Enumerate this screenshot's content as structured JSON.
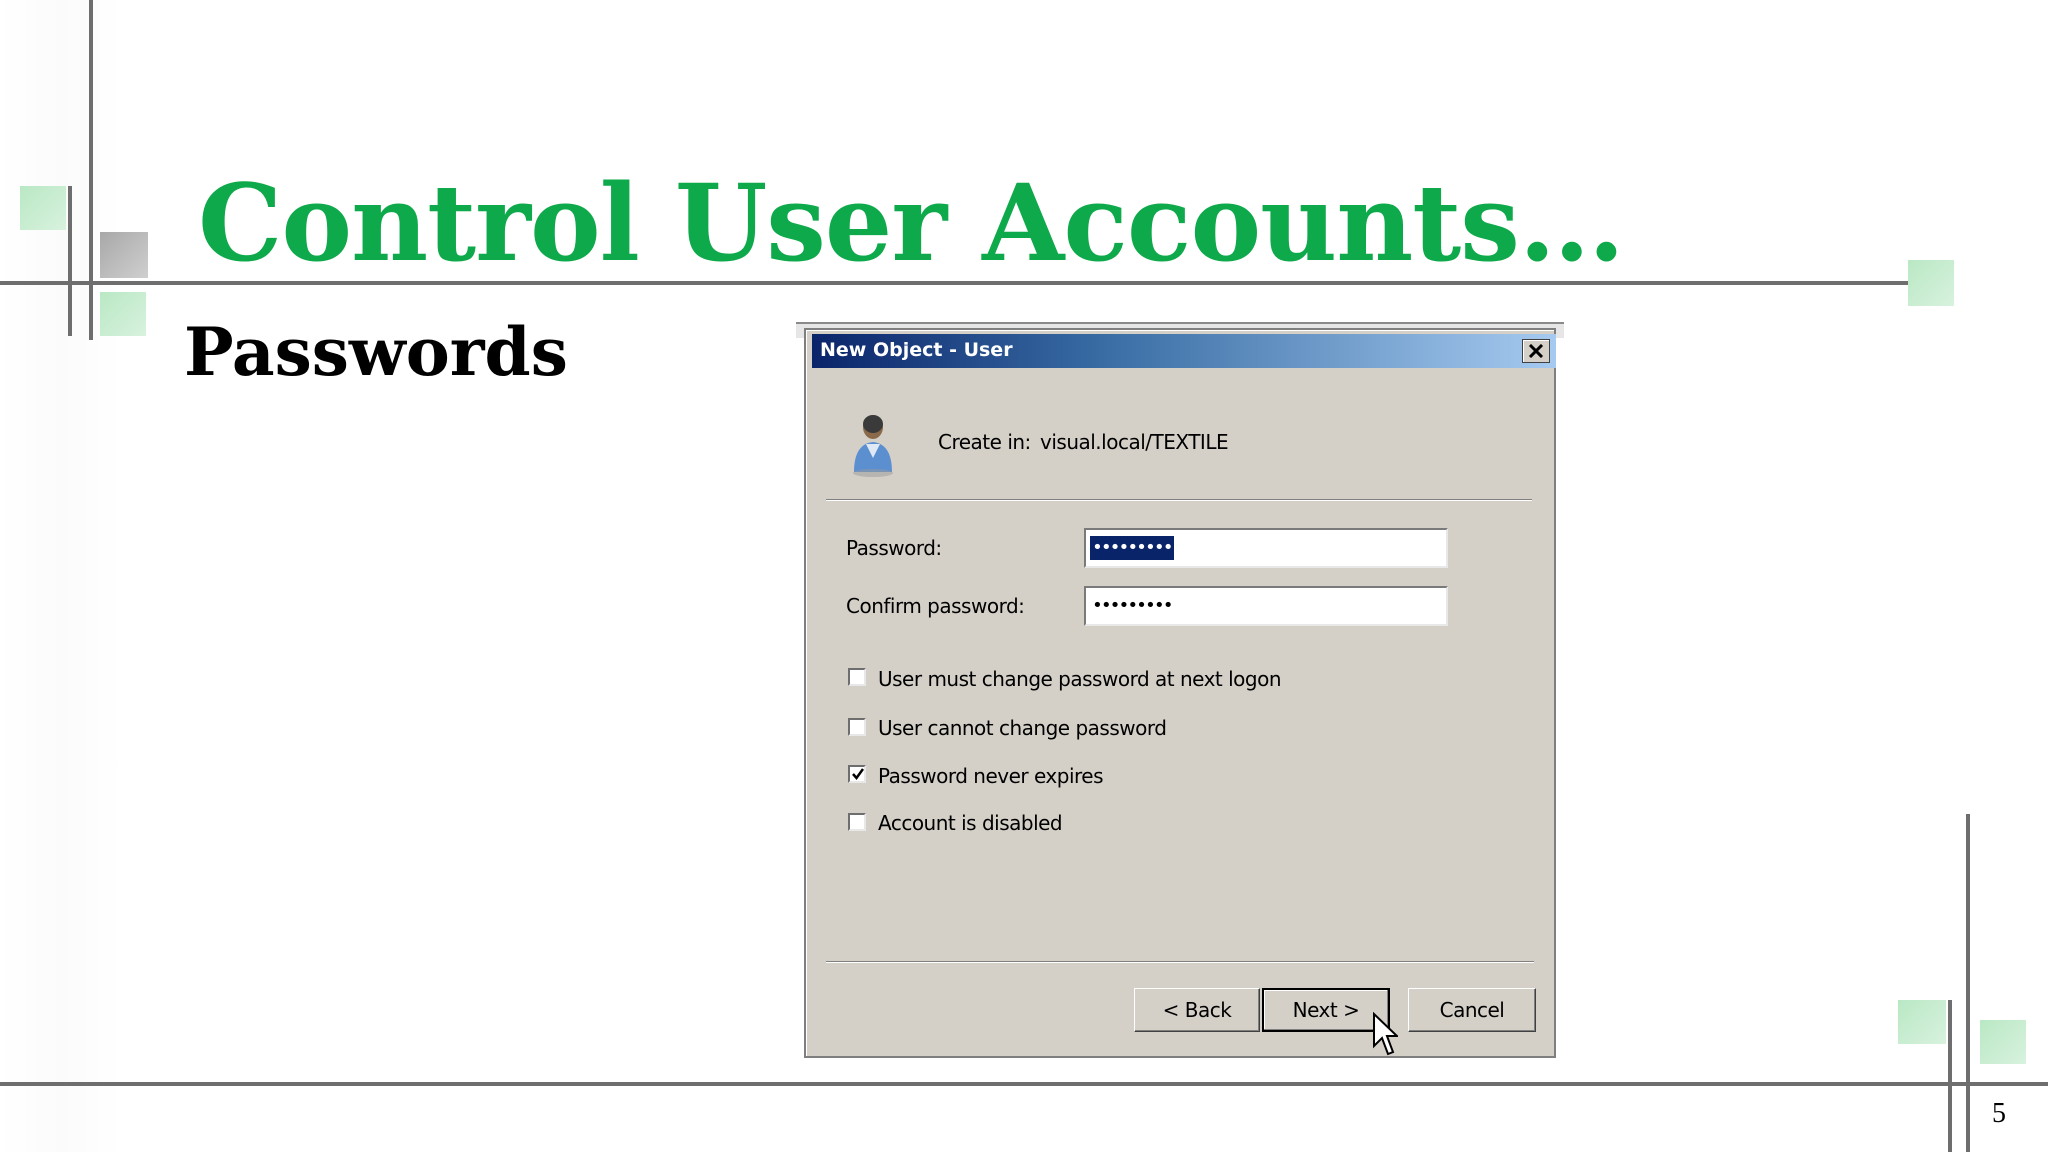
{
  "slide": {
    "title": "Control User Accounts…",
    "subtitle": "Passwords",
    "page_number": "5",
    "accent_color": "#0ea94a"
  },
  "dialog": {
    "title": "New Object - User",
    "create_in_label": "Create in:",
    "create_in_value": "visual.local/TEXTILE",
    "password_label": "Password:",
    "password_value": "•••••••••",
    "confirm_label": "Confirm password:",
    "confirm_value": "•••••••••",
    "options": [
      {
        "label": "User must change password at next logon",
        "checked": false
      },
      {
        "label": "User cannot change password",
        "checked": false
      },
      {
        "label": "Password never expires",
        "checked": true
      },
      {
        "label": "Account is disabled",
        "checked": false
      }
    ],
    "buttons": {
      "back": "< Back",
      "next": "Next >",
      "cancel": "Cancel"
    },
    "icons": {
      "user": "user-icon",
      "close": "close-icon",
      "cursor": "mouse-pointer-icon"
    }
  }
}
